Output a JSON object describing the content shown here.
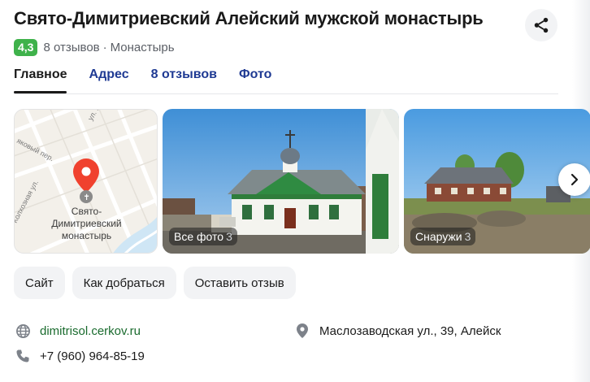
{
  "header": {
    "title": "Свято-Димитриевский Алейский мужской монастырь",
    "rating": "4,3",
    "reviews_text": "8 отзывов",
    "separator": "·",
    "category": "Монастырь"
  },
  "tabs": [
    {
      "label": "Главное",
      "active": true
    },
    {
      "label": "Адрес",
      "active": false
    },
    {
      "label": "8 отзывов",
      "active": false
    },
    {
      "label": "Фото",
      "active": false
    }
  ],
  "map": {
    "place_label_line1": "Свято-",
    "place_label_line2": "Димитриевский",
    "place_label_line3": "монастырь",
    "street_1": "ул. К",
    "street_2": "яковый пер.",
    "street_3": "Колхозная ул."
  },
  "photos": [
    {
      "label": "Все фото",
      "count": "3"
    },
    {
      "label": "Снаружи",
      "count": "3"
    }
  ],
  "actions": {
    "site": "Сайт",
    "route": "Как добраться",
    "review": "Оставить отзыв"
  },
  "contacts": {
    "website": "dimitrisol.cerkov.ru",
    "phone": "+7 (960) 964-85-19",
    "address": "Маслозаводская ул., 39, Алейск"
  },
  "colors": {
    "rating_badge": "#3fb24b",
    "link": "#1f3a93",
    "pin": "#f0412e"
  },
  "icons": {
    "share": "share-icon",
    "next": "chevron-right-icon",
    "globe": "globe-icon",
    "phone": "phone-icon",
    "location": "location-pin-icon"
  }
}
